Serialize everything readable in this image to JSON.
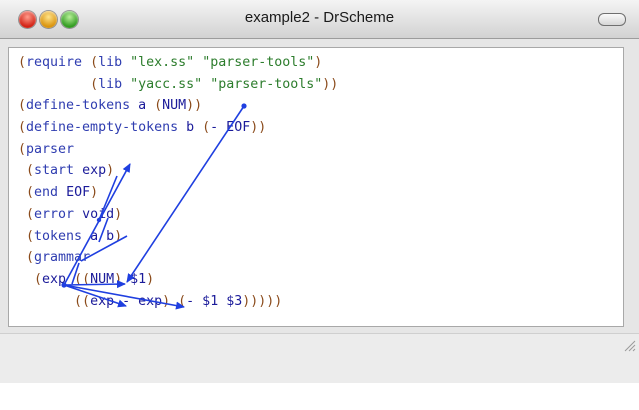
{
  "window": {
    "title": "example2 - DrScheme"
  },
  "code": [
    [
      {
        "c": "paren",
        "t": "("
      },
      {
        "c": "kw",
        "t": "require"
      },
      {
        "c": "",
        "t": " "
      },
      {
        "c": "paren",
        "t": "("
      },
      {
        "c": "kw",
        "t": "lib"
      },
      {
        "c": "",
        "t": " "
      },
      {
        "c": "str",
        "t": "\"lex.ss\""
      },
      {
        "c": "",
        "t": " "
      },
      {
        "c": "str",
        "t": "\"parser-tools\""
      },
      {
        "c": "paren",
        "t": ")"
      }
    ],
    [
      {
        "c": "",
        "t": "         "
      },
      {
        "c": "paren",
        "t": "("
      },
      {
        "c": "kw",
        "t": "lib"
      },
      {
        "c": "",
        "t": " "
      },
      {
        "c": "str",
        "t": "\"yacc.ss\""
      },
      {
        "c": "",
        "t": " "
      },
      {
        "c": "str",
        "t": "\"parser-tools\""
      },
      {
        "c": "paren",
        "t": "))"
      }
    ],
    [
      {
        "c": "paren",
        "t": "("
      },
      {
        "c": "kw",
        "t": "define-tokens"
      },
      {
        "c": "",
        "t": " a "
      },
      {
        "c": "paren",
        "t": "("
      },
      {
        "c": "",
        "t": "NUM"
      },
      {
        "c": "paren",
        "t": "))"
      }
    ],
    [
      {
        "c": "paren",
        "t": "("
      },
      {
        "c": "kw",
        "t": "define-empty-tokens"
      },
      {
        "c": "",
        "t": " b "
      },
      {
        "c": "paren",
        "t": "("
      },
      {
        "c": "",
        "t": "- EOF"
      },
      {
        "c": "paren",
        "t": "))"
      }
    ],
    [
      {
        "c": "paren",
        "t": "("
      },
      {
        "c": "kw",
        "t": "parser"
      }
    ],
    [
      {
        "c": "",
        "t": " "
      },
      {
        "c": "paren",
        "t": "("
      },
      {
        "c": "kw",
        "t": "start"
      },
      {
        "c": "",
        "t": " exp"
      },
      {
        "c": "paren",
        "t": ")"
      }
    ],
    [
      {
        "c": "",
        "t": " "
      },
      {
        "c": "paren",
        "t": "("
      },
      {
        "c": "kw",
        "t": "end"
      },
      {
        "c": "",
        "t": " EOF"
      },
      {
        "c": "paren",
        "t": ")"
      }
    ],
    [
      {
        "c": "",
        "t": " "
      },
      {
        "c": "paren",
        "t": "("
      },
      {
        "c": "kw",
        "t": "error"
      },
      {
        "c": "",
        "t": " void"
      },
      {
        "c": "paren",
        "t": ")"
      }
    ],
    [
      {
        "c": "",
        "t": " "
      },
      {
        "c": "paren",
        "t": "("
      },
      {
        "c": "kw",
        "t": "tokens"
      },
      {
        "c": "",
        "t": " a b"
      },
      {
        "c": "paren",
        "t": ")"
      }
    ],
    [
      {
        "c": "",
        "t": " "
      },
      {
        "c": "paren",
        "t": "("
      },
      {
        "c": "kw",
        "t": "grammar"
      }
    ],
    [
      {
        "c": "",
        "t": "  "
      },
      {
        "c": "paren",
        "t": "("
      },
      {
        "c": "",
        "t": "exp "
      },
      {
        "c": "paren",
        "t": "(("
      },
      {
        "c": "",
        "t": "NUM"
      },
      {
        "c": "paren",
        "t": ")"
      },
      {
        "c": "",
        "t": " $1"
      },
      {
        "c": "paren",
        "t": ")"
      }
    ],
    [
      {
        "c": "",
        "t": "       "
      },
      {
        "c": "paren",
        "t": "(("
      },
      {
        "c": "",
        "t": "exp - exp"
      },
      {
        "c": "paren",
        "t": ")"
      },
      {
        "c": "",
        "t": " "
      },
      {
        "c": "paren",
        "t": "("
      },
      {
        "c": "",
        "t": "- $1 $3"
      },
      {
        "c": "paren",
        "t": ")))))"
      }
    ]
  ],
  "colors": {
    "arrow": "#1f3fe0",
    "keyword": "#2f3db0",
    "string": "#2d7d2d",
    "paren": "#8a4a1a"
  }
}
